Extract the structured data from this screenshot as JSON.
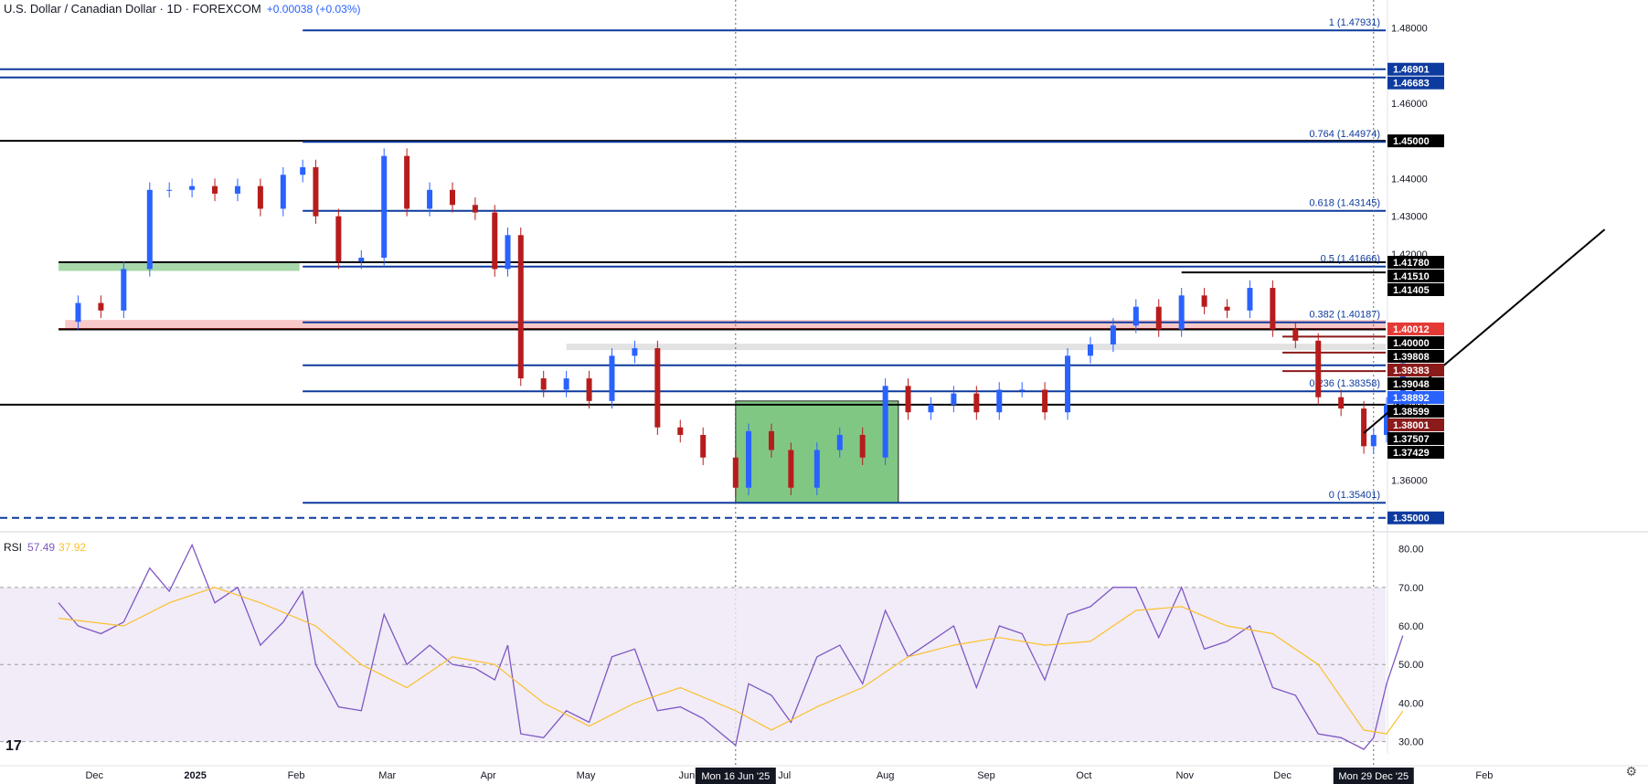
{
  "header": {
    "title": "U.S. Dollar / Canadian Dollar · 1D · FOREXCOM",
    "change": "+0.00038 (+0.03%)"
  },
  "rsi_header": {
    "label": "RSI",
    "value": "57.49",
    "ma": "37.92"
  },
  "colors": {
    "up": "#2962ff",
    "down": "#b71c1c",
    "blue_line": "#0d3a9e",
    "black_line": "#000000",
    "red_line": "#8b1a1a",
    "support_zone": "#4caf50",
    "rsi_line": "#7e57c2",
    "rsi_ma": "#fbc02d",
    "rsi_band": "#ede7f6"
  },
  "chart_data": [
    {
      "type": "candlestick",
      "title": "U.S. Dollar / Canadian Dollar · 1D · FOREXCOM",
      "ylim": [
        1.348,
        1.483
      ],
      "y_ticks": [
        "1.48000",
        "1.46000",
        "1.44000",
        "1.43000",
        "1.42000",
        "1.40000",
        "1.38000",
        "1.36000"
      ],
      "x_ticks": [
        "Dec",
        "2025",
        "Feb",
        "Mar",
        "Apr",
        "May",
        "Jun",
        "Jul",
        "Aug",
        "Sep",
        "Oct",
        "Nov",
        "Dec",
        "Feb"
      ],
      "crosshair_labels": [
        "Mon 16 Jun '25",
        "Mon 29 Dec '25"
      ],
      "price_labels": [
        {
          "value": "1.46901",
          "style": "blue"
        },
        {
          "value": "1.46683",
          "style": "blue"
        },
        {
          "value": "1.45000",
          "style": "black"
        },
        {
          "value": "1.41780",
          "style": "black"
        },
        {
          "value": "1.41510",
          "style": "black"
        },
        {
          "value": "1.41405",
          "style": "black"
        },
        {
          "value": "1.40012",
          "style": "red"
        },
        {
          "value": "1.40000",
          "style": "black"
        },
        {
          "value": "1.39808",
          "style": "black"
        },
        {
          "value": "1.39383",
          "style": "darkred"
        },
        {
          "value": "1.39048",
          "style": "black"
        },
        {
          "value": "1.38892",
          "style": "lightblue"
        },
        {
          "value": "1.38599",
          "style": "black"
        },
        {
          "value": "1.38001",
          "style": "darkred"
        },
        {
          "value": "1.37507",
          "style": "black"
        },
        {
          "value": "1.37429",
          "style": "black"
        },
        {
          "value": "1.35000",
          "style": "blue"
        }
      ],
      "fib_levels": [
        {
          "label": "1 (1.47931)",
          "value": 1.47931
        },
        {
          "label": "0.764 (1.44974)",
          "value": 1.44974
        },
        {
          "label": "0.618 (1.43145)",
          "value": 1.43145
        },
        {
          "label": "0.5 (1.41666)",
          "value": 1.41666
        },
        {
          "label": "0.382 (1.40187)",
          "value": 1.40187
        },
        {
          "label": "0.236 (1.38358)",
          "value": 1.38358
        },
        {
          "label": "0 (1.35401)",
          "value": 1.35401
        }
      ],
      "horizontal_levels": [
        {
          "value": 1.46901,
          "color": "blue",
          "from": "start"
        },
        {
          "value": 1.46683,
          "color": "blue",
          "from": "start"
        },
        {
          "value": 1.45,
          "color": "black",
          "from": "start"
        },
        {
          "value": 1.4178,
          "color": "black",
          "from": "Dec"
        },
        {
          "value": 1.4151,
          "color": "black",
          "from": "Nov"
        },
        {
          "value": 1.40012,
          "color": "red",
          "from": "Dec"
        },
        {
          "value": 1.4,
          "color": "black",
          "from": "Dec"
        },
        {
          "value": 1.39808,
          "color": "darkred",
          "from": "Dec"
        },
        {
          "value": 1.39383,
          "color": "darkred",
          "from": "Dec"
        },
        {
          "value": 1.39048,
          "color": "blue",
          "from": "Feb"
        },
        {
          "value": 1.38892,
          "color": "darkred",
          "from": "Dec"
        },
        {
          "value": 1.38001,
          "color": "black",
          "from": "start"
        },
        {
          "value": 1.35,
          "color": "blue",
          "dashed": true,
          "from": "start"
        }
      ],
      "zones": [
        {
          "name": "green support zone 2024",
          "low": 1.4155,
          "high": 1.418
        },
        {
          "name": "green support zone Jun-Jul",
          "low": 1.35401,
          "high": 1.381
        },
        {
          "name": "red resistance zone",
          "low": 1.4,
          "high": 1.4025
        },
        {
          "name": "grey zone",
          "low": 1.3945,
          "high": 1.3962
        }
      ],
      "close_path": [
        {
          "x": "2024-11-20",
          "y": 1.402
        },
        {
          "x": "2024-11-26",
          "y": 1.407
        },
        {
          "x": "2024-12-03",
          "y": 1.405
        },
        {
          "x": "2024-12-10",
          "y": 1.416
        },
        {
          "x": "2024-12-18",
          "y": 1.437
        },
        {
          "x": "2024-12-24",
          "y": 1.437
        },
        {
          "x": "2024-12-31",
          "y": 1.438
        },
        {
          "x": "2025-01-07",
          "y": 1.436
        },
        {
          "x": "2025-01-14",
          "y": 1.438
        },
        {
          "x": "2025-01-21",
          "y": 1.432
        },
        {
          "x": "2025-01-28",
          "y": 1.441
        },
        {
          "x": "2025-02-03",
          "y": 1.443
        },
        {
          "x": "2025-02-07",
          "y": 1.43
        },
        {
          "x": "2025-02-14",
          "y": 1.418
        },
        {
          "x": "2025-02-21",
          "y": 1.419
        },
        {
          "x": "2025-02-28",
          "y": 1.446
        },
        {
          "x": "2025-03-07",
          "y": 1.432
        },
        {
          "x": "2025-03-14",
          "y": 1.437
        },
        {
          "x": "2025-03-21",
          "y": 1.433
        },
        {
          "x": "2025-03-28",
          "y": 1.431
        },
        {
          "x": "2025-04-03",
          "y": 1.416
        },
        {
          "x": "2025-04-07",
          "y": 1.425
        },
        {
          "x": "2025-04-11",
          "y": 1.387
        },
        {
          "x": "2025-04-18",
          "y": 1.384
        },
        {
          "x": "2025-04-25",
          "y": 1.387
        },
        {
          "x": "2025-05-02",
          "y": 1.381
        },
        {
          "x": "2025-05-09",
          "y": 1.393
        },
        {
          "x": "2025-05-16",
          "y": 1.395
        },
        {
          "x": "2025-05-23",
          "y": 1.374
        },
        {
          "x": "2025-05-30",
          "y": 1.372
        },
        {
          "x": "2025-06-06",
          "y": 1.366
        },
        {
          "x": "2025-06-16",
          "y": 1.358
        },
        {
          "x": "2025-06-20",
          "y": 1.373
        },
        {
          "x": "2025-06-27",
          "y": 1.368
        },
        {
          "x": "2025-07-03",
          "y": 1.358
        },
        {
          "x": "2025-07-11",
          "y": 1.368
        },
        {
          "x": "2025-07-18",
          "y": 1.372
        },
        {
          "x": "2025-07-25",
          "y": 1.366
        },
        {
          "x": "2025-08-01",
          "y": 1.385
        },
        {
          "x": "2025-08-08",
          "y": 1.378
        },
        {
          "x": "2025-08-15",
          "y": 1.38
        },
        {
          "x": "2025-08-22",
          "y": 1.383
        },
        {
          "x": "2025-08-29",
          "y": 1.378
        },
        {
          "x": "2025-09-05",
          "y": 1.384
        },
        {
          "x": "2025-09-12",
          "y": 1.384
        },
        {
          "x": "2025-09-19",
          "y": 1.378
        },
        {
          "x": "2025-09-26",
          "y": 1.393
        },
        {
          "x": "2025-10-03",
          "y": 1.396
        },
        {
          "x": "2025-10-10",
          "y": 1.401
        },
        {
          "x": "2025-10-17",
          "y": 1.406
        },
        {
          "x": "2025-10-24",
          "y": 1.4
        },
        {
          "x": "2025-10-31",
          "y": 1.409
        },
        {
          "x": "2025-11-07",
          "y": 1.406
        },
        {
          "x": "2025-11-14",
          "y": 1.405
        },
        {
          "x": "2025-11-21",
          "y": 1.411
        },
        {
          "x": "2025-11-28",
          "y": 1.4
        },
        {
          "x": "2025-12-05",
          "y": 1.397
        },
        {
          "x": "2025-12-12",
          "y": 1.382
        },
        {
          "x": "2025-12-19",
          "y": 1.379
        },
        {
          "x": "2025-12-26",
          "y": 1.369
        },
        {
          "x": "2025-12-29",
          "y": 1.372
        },
        {
          "x": "2026-01-02",
          "y": 1.38
        },
        {
          "x": "2026-01-07",
          "y": 1.391
        }
      ],
      "trendline": {
        "from": {
          "x": "2025-12-26",
          "y": 1.3725
        },
        "to": {
          "x": "2026-03-10",
          "y": 1.4265
        }
      }
    },
    {
      "type": "line",
      "title": "RSI",
      "ylim": [
        28,
        83
      ],
      "y_ticks": [
        "80.00",
        "70.00",
        "60.00",
        "50.00",
        "40.00",
        "30.00"
      ],
      "band": [
        30,
        70
      ],
      "series": [
        {
          "name": "RSI",
          "values": [
            {
              "x": "2024-11-20",
              "y": 66
            },
            {
              "x": "2024-11-26",
              "y": 60
            },
            {
              "x": "2024-12-03",
              "y": 58
            },
            {
              "x": "2024-12-10",
              "y": 61
            },
            {
              "x": "2024-12-18",
              "y": 75
            },
            {
              "x": "2024-12-24",
              "y": 69
            },
            {
              "x": "2024-12-31",
              "y": 81
            },
            {
              "x": "2025-01-07",
              "y": 66
            },
            {
              "x": "2025-01-14",
              "y": 70
            },
            {
              "x": "2025-01-21",
              "y": 55
            },
            {
              "x": "2025-01-28",
              "y": 61
            },
            {
              "x": "2025-02-03",
              "y": 69
            },
            {
              "x": "2025-02-07",
              "y": 50
            },
            {
              "x": "2025-02-14",
              "y": 39
            },
            {
              "x": "2025-02-21",
              "y": 38
            },
            {
              "x": "2025-02-28",
              "y": 63
            },
            {
              "x": "2025-03-07",
              "y": 50
            },
            {
              "x": "2025-03-14",
              "y": 55
            },
            {
              "x": "2025-03-21",
              "y": 50
            },
            {
              "x": "2025-03-28",
              "y": 49
            },
            {
              "x": "2025-04-03",
              "y": 46
            },
            {
              "x": "2025-04-07",
              "y": 55
            },
            {
              "x": "2025-04-11",
              "y": 32
            },
            {
              "x": "2025-04-18",
              "y": 31
            },
            {
              "x": "2025-04-25",
              "y": 38
            },
            {
              "x": "2025-05-02",
              "y": 35
            },
            {
              "x": "2025-05-09",
              "y": 52
            },
            {
              "x": "2025-05-16",
              "y": 54
            },
            {
              "x": "2025-05-23",
              "y": 38
            },
            {
              "x": "2025-05-30",
              "y": 39
            },
            {
              "x": "2025-06-06",
              "y": 36
            },
            {
              "x": "2025-06-16",
              "y": 29
            },
            {
              "x": "2025-06-20",
              "y": 45
            },
            {
              "x": "2025-06-27",
              "y": 42
            },
            {
              "x": "2025-07-03",
              "y": 35
            },
            {
              "x": "2025-07-11",
              "y": 52
            },
            {
              "x": "2025-07-18",
              "y": 55
            },
            {
              "x": "2025-07-25",
              "y": 45
            },
            {
              "x": "2025-08-01",
              "y": 64
            },
            {
              "x": "2025-08-08",
              "y": 52
            },
            {
              "x": "2025-08-15",
              "y": 56
            },
            {
              "x": "2025-08-22",
              "y": 60
            },
            {
              "x": "2025-08-29",
              "y": 44
            },
            {
              "x": "2025-09-05",
              "y": 60
            },
            {
              "x": "2025-09-12",
              "y": 58
            },
            {
              "x": "2025-09-19",
              "y": 46
            },
            {
              "x": "2025-09-26",
              "y": 63
            },
            {
              "x": "2025-10-03",
              "y": 65
            },
            {
              "x": "2025-10-10",
              "y": 70
            },
            {
              "x": "2025-10-17",
              "y": 70
            },
            {
              "x": "2025-10-24",
              "y": 57
            },
            {
              "x": "2025-10-31",
              "y": 70
            },
            {
              "x": "2025-11-07",
              "y": 54
            },
            {
              "x": "2025-11-14",
              "y": 56
            },
            {
              "x": "2025-11-21",
              "y": 60
            },
            {
              "x": "2025-11-28",
              "y": 44
            },
            {
              "x": "2025-12-05",
              "y": 42
            },
            {
              "x": "2025-12-12",
              "y": 32
            },
            {
              "x": "2025-12-19",
              "y": 31
            },
            {
              "x": "2025-12-26",
              "y": 28
            },
            {
              "x": "2025-12-29",
              "y": 31
            },
            {
              "x": "2026-01-02",
              "y": 45
            },
            {
              "x": "2026-01-07",
              "y": 57.49
            }
          ]
        },
        {
          "name": "MA",
          "values": [
            {
              "x": "2024-11-20",
              "y": 62
            },
            {
              "x": "2024-12-10",
              "y": 60
            },
            {
              "x": "2024-12-24",
              "y": 66
            },
            {
              "x": "2025-01-07",
              "y": 70
            },
            {
              "x": "2025-01-21",
              "y": 66
            },
            {
              "x": "2025-02-07",
              "y": 60
            },
            {
              "x": "2025-02-21",
              "y": 50
            },
            {
              "x": "2025-03-07",
              "y": 44
            },
            {
              "x": "2025-03-21",
              "y": 52
            },
            {
              "x": "2025-04-03",
              "y": 50
            },
            {
              "x": "2025-04-18",
              "y": 40
            },
            {
              "x": "2025-05-02",
              "y": 34
            },
            {
              "x": "2025-05-16",
              "y": 40
            },
            {
              "x": "2025-05-30",
              "y": 44
            },
            {
              "x": "2025-06-16",
              "y": 38
            },
            {
              "x": "2025-06-27",
              "y": 33
            },
            {
              "x": "2025-07-11",
              "y": 39
            },
            {
              "x": "2025-07-25",
              "y": 44
            },
            {
              "x": "2025-08-08",
              "y": 52
            },
            {
              "x": "2025-08-22",
              "y": 55
            },
            {
              "x": "2025-09-05",
              "y": 57
            },
            {
              "x": "2025-09-19",
              "y": 55
            },
            {
              "x": "2025-10-03",
              "y": 56
            },
            {
              "x": "2025-10-17",
              "y": 64
            },
            {
              "x": "2025-10-31",
              "y": 65
            },
            {
              "x": "2025-11-14",
              "y": 60
            },
            {
              "x": "2025-11-28",
              "y": 58
            },
            {
              "x": "2025-12-12",
              "y": 50
            },
            {
              "x": "2025-12-26",
              "y": 33
            },
            {
              "x": "2026-01-02",
              "y": 32
            },
            {
              "x": "2026-01-07",
              "y": 37.92
            }
          ]
        }
      ]
    }
  ]
}
